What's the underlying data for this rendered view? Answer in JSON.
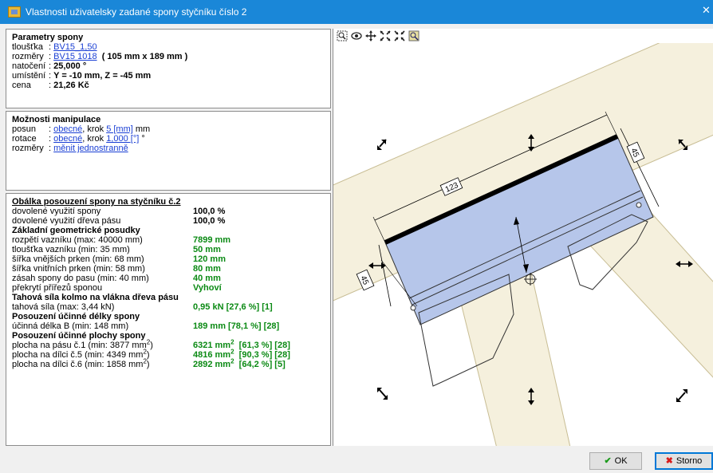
{
  "window": {
    "title": "Vlastnosti uživatelsky zadané spony styčníku číslo 2",
    "close": "✕"
  },
  "params": {
    "header": "Parametry spony",
    "thickness_label": "tloušťka",
    "thickness_value": "BV15_1,50",
    "dims_label": "rozměry",
    "dims_value": "BV15 1018",
    "dims_extra": "( 105 mm x 189 mm )",
    "rotation_label": "natočení",
    "rotation_value": "25,000 °",
    "position_label": "umístění",
    "position_value": "Y = -10 mm, Z = -45 mm",
    "price_label": "cena",
    "price_value": "21,26 Kč"
  },
  "manip": {
    "header": "Možnosti manipulace",
    "shift_label": "posun",
    "shift_mode": "obecné",
    "shift_step_label": ", krok",
    "shift_step": "5 [mm]",
    "shift_unit": "mm",
    "rot_label": "rotace",
    "rot_mode": "obecné",
    "rot_step_label": ", krok",
    "rot_step": "1,000 [°]",
    "rot_unit": "°",
    "dims_label": "rozměry",
    "dims_mode": "měnit jednostranně"
  },
  "check": {
    "header": "Obálka posouzení spony na styčníku č.2",
    "allowed_plate_label": "dovolené využití spony",
    "allowed_plate_value": "100,0 %",
    "allowed_wood_label": "dovolené využití dřeva pásu",
    "allowed_wood_value": "100,0 %",
    "geo_header": "Základní geometrické posudky",
    "span_label": "rozpětí vazníku (max: 40000 mm)",
    "span_value": "7899 mm",
    "truss_thick_label": "tloušťka vazníku (min: 35 mm)",
    "truss_thick_value": "50 mm",
    "outer_label": "šířka vnějších prken (min: 68 mm)",
    "outer_value": "120 mm",
    "inner_label": "šířka vnitřních prken (min: 58 mm)",
    "inner_value": "80 mm",
    "reach_label": "zásah spony do pasu (min: 40 mm)",
    "reach_value": "40 mm",
    "overlap_label": "překrytí přířezů sponou",
    "overlap_value": "Vyhoví",
    "tension_header": "Tahová síla kolmo na vlákna dřeva pásu",
    "tension_label": "tahová síla (max: 3,44 kN)",
    "tension_value": "0,95 kN  [27,6 %] [1]",
    "eff_len_header": "Posouzení účinné délky spony",
    "eff_len_label": "účinná délka B (min: 148 mm)",
    "eff_len_value": "189 mm  [78,1 %] [28]",
    "eff_area_header": "Posouzení účinné plochy spony",
    "area1_label": "plocha na pásu č.1 (min: 3877 mm",
    "area1_value": "6321 mm",
    "area1_pct": "[61,3 %] [28]",
    "area5_label": "plocha na dílci č.5 (min: 4349 mm",
    "area5_value": "4816 mm",
    "area5_pct": "[90,3 %] [28]",
    "area6_label": "plocha na dílci č.6 (min: 1858 mm",
    "area6_value": "2892 mm",
    "area6_pct": "[64,2 %] [5]",
    "sup": "2",
    "close_paren": ")"
  },
  "drawing": {
    "dim_top": "123",
    "dim_right": "45",
    "dim_left": "45"
  },
  "toolbar": {
    "zoom_icon": "magnifier-icon",
    "eye_icon": "eye-icon"
  },
  "buttons": {
    "ok": "OK",
    "storno": "Storno",
    "ok_glyph": "✔",
    "storno_glyph": "✖"
  },
  "colors": {
    "title_bar": "#1a87d8",
    "plate": "#b6c6ea",
    "wood": "#f5f0dd",
    "green": "#0b8a14",
    "link": "#1a3fd4"
  }
}
